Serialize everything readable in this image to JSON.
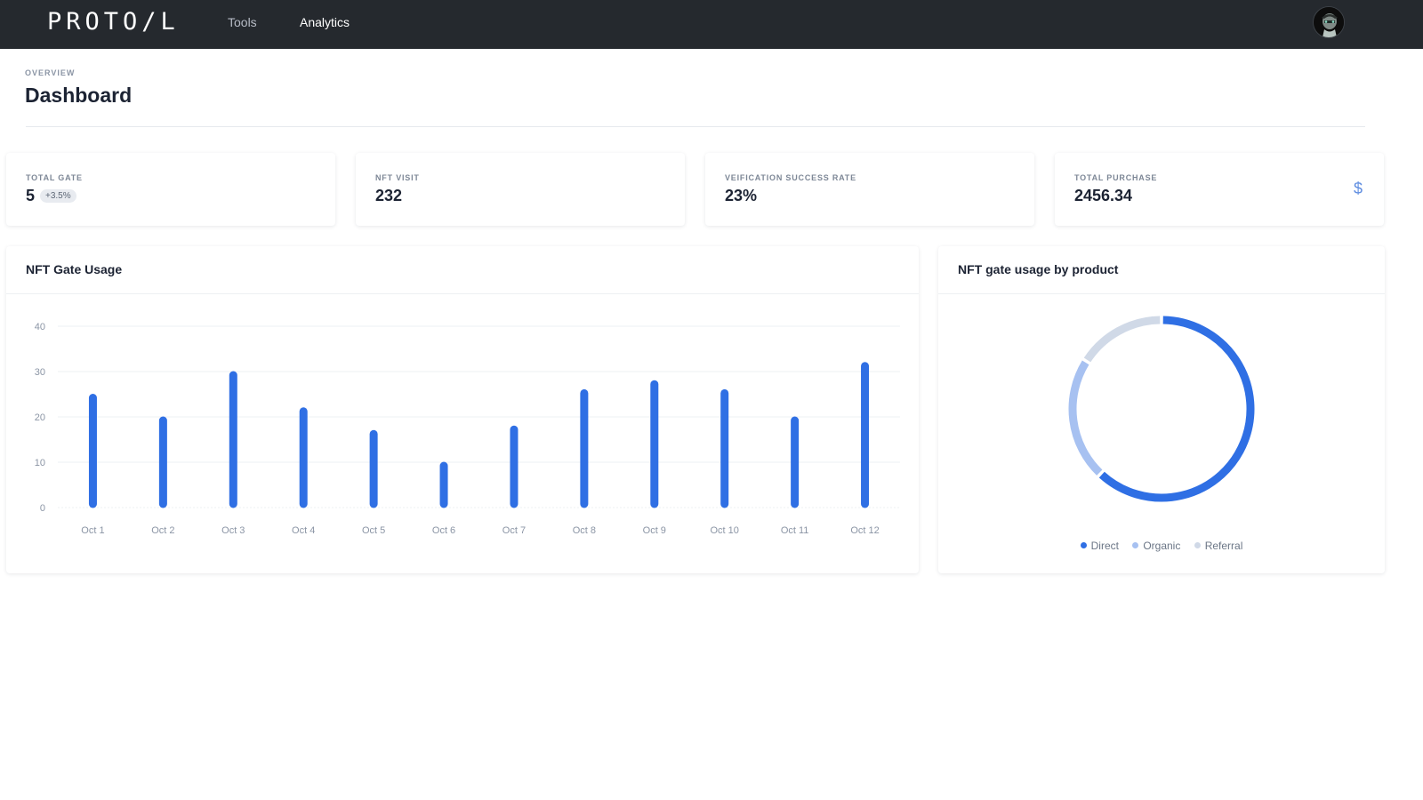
{
  "header": {
    "logo": "PROTO/L",
    "nav": [
      {
        "label": "Tools",
        "active": false
      },
      {
        "label": "Analytics",
        "active": true
      }
    ]
  },
  "page": {
    "overline": "OVERVIEW",
    "title": "Dashboard"
  },
  "stats": [
    {
      "label": "TOTAL GATE",
      "value": "5",
      "badge": "+3.5%"
    },
    {
      "label": "NFT VISIT",
      "value": "232"
    },
    {
      "label": "VEIFICATION SUCCESS RATE",
      "value": "23%"
    },
    {
      "label": "TOTAL PURCHASE",
      "value": "2456.34",
      "icon": "dollar-icon"
    }
  ],
  "colors": {
    "topbar": "#25292e",
    "accent": "#2f6fe4",
    "organic": "#a7c1f1",
    "referral": "#d0d9e7"
  },
  "usage_panel": {
    "title": "NFT Gate Usage"
  },
  "product_panel": {
    "title": "NFT gate usage by product"
  },
  "chart_data": [
    {
      "type": "bar",
      "title": "NFT Gate Usage",
      "categories": [
        "Oct 1",
        "Oct 2",
        "Oct 3",
        "Oct 4",
        "Oct 5",
        "Oct 6",
        "Oct 7",
        "Oct 8",
        "Oct 9",
        "Oct 10",
        "Oct 11",
        "Oct 12"
      ],
      "values": [
        25,
        20,
        30,
        22,
        17,
        10,
        18,
        26,
        28,
        26,
        20,
        32
      ],
      "ylim": [
        0,
        40
      ],
      "yticks": [
        0,
        10,
        20,
        30,
        40
      ],
      "grid": true,
      "legend": "none",
      "color": "#2f6fe4"
    },
    {
      "type": "pie",
      "title": "NFT gate usage by product",
      "donut": true,
      "labels": [
        "Direct",
        "Organic",
        "Referral"
      ],
      "values": [
        62,
        22,
        16
      ],
      "colors": [
        "#2f6fe4",
        "#a7c1f1",
        "#d0d9e7"
      ],
      "legend": "bottom"
    }
  ]
}
